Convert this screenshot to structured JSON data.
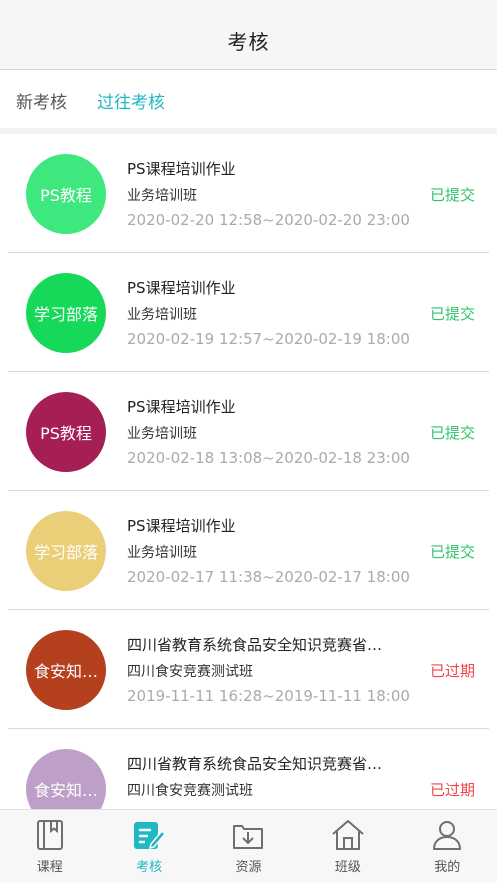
{
  "header": {
    "title": "考核"
  },
  "tabs": {
    "new_label": "新考核",
    "past_label": "过往考核"
  },
  "items": [
    {
      "avatar_text": "PS教程",
      "avatar_color": "#3ee87e",
      "title": "PS课程培训作业",
      "class_name": "业务培训班",
      "time_range": "2020-02-20 12:58~2020-02-20 23:00",
      "status": "已提交",
      "status_color": "#2ec46a"
    },
    {
      "avatar_text": "学习部落",
      "avatar_color": "#16d95a",
      "title": "PS课程培训作业",
      "class_name": "业务培训班",
      "time_range": "2020-02-19 12:57~2020-02-19 18:00",
      "status": "已提交",
      "status_color": "#2ec46a"
    },
    {
      "avatar_text": "PS教程",
      "avatar_color": "#a51e55",
      "title": "PS课程培训作业",
      "class_name": "业务培训班",
      "time_range": "2020-02-18 13:08~2020-02-18 23:00",
      "status": "已提交",
      "status_color": "#2ec46a"
    },
    {
      "avatar_text": "学习部落",
      "avatar_color": "#ebce78",
      "title": "PS课程培训作业",
      "class_name": "业务培训班",
      "time_range": "2020-02-17 11:38~2020-02-17 18:00",
      "status": "已提交",
      "status_color": "#2ec46a"
    },
    {
      "avatar_text": "食安知…",
      "avatar_color": "#b5401d",
      "title": "四川省教育系统食品安全知识竞赛省…",
      "class_name": "四川食安竞赛测试班",
      "time_range": "2019-11-11 16:28~2019-11-11 18:00",
      "status": "已过期",
      "status_color": "#f0454c"
    },
    {
      "avatar_text": "食安知…",
      "avatar_color": "#bd9fc7",
      "title": "四川省教育系统食品安全知识竞赛省…",
      "class_name": "四川食安竞赛测试班",
      "time_range": "",
      "status": "已过期",
      "status_color": "#f0454c"
    }
  ],
  "tabbar": {
    "active_color": "#1fb8c3",
    "items": [
      {
        "label": "课程",
        "icon": "book-icon"
      },
      {
        "label": "考核",
        "icon": "exam-edit-icon"
      },
      {
        "label": "资源",
        "icon": "download-box-icon"
      },
      {
        "label": "班级",
        "icon": "house-icon"
      },
      {
        "label": "我的",
        "icon": "person-icon"
      }
    ]
  }
}
